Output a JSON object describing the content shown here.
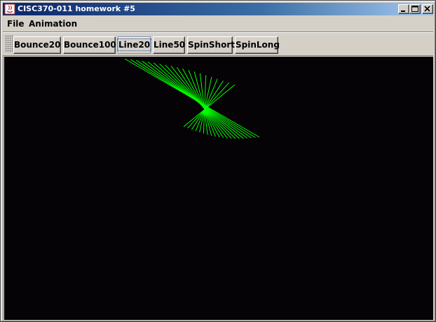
{
  "window": {
    "title": "CISC370-011 homework #5"
  },
  "menu": {
    "items": [
      {
        "label": "File"
      },
      {
        "label": "Animation"
      }
    ]
  },
  "toolbar": {
    "buttons": [
      {
        "label": "Bounce20"
      },
      {
        "label": "Bounce100"
      },
      {
        "label": "Line20",
        "focused": true
      },
      {
        "label": "Line50"
      },
      {
        "label": "SpinShort"
      },
      {
        "label": "SpinLong"
      }
    ]
  },
  "canvas": {
    "background": "#050305",
    "line_color": "#00ff00",
    "line_count": 20
  },
  "colors": {
    "title_start": "#0a246a",
    "title_end": "#a6caf0",
    "chrome": "#d4d0c8"
  }
}
